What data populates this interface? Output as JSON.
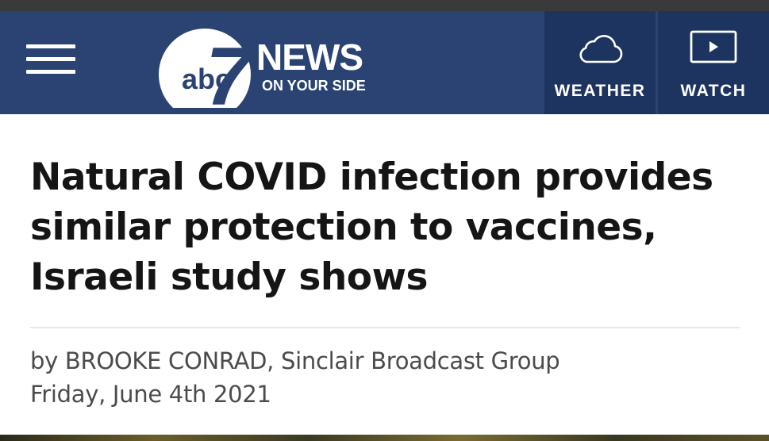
{
  "header": {
    "logo": {
      "brand": "abc",
      "channel": "7",
      "title": "NEWS",
      "tagline": "ON YOUR SIDE"
    },
    "weather": {
      "label": "WEATHER",
      "icon": "cloud-icon"
    },
    "watch": {
      "label": "WATCH",
      "icon": "play-icon"
    },
    "colors": {
      "header_bg": "#2a4372",
      "button_bg": "#1e3460",
      "text": "#ffffff"
    }
  },
  "article": {
    "headline": "Natural COVID infection provides similar protection to vaccines, Israeli study shows",
    "byline": "by BROOKE CONRAD, Sinclair Broadcast Group",
    "date": "Friday, June 4th 2021"
  }
}
